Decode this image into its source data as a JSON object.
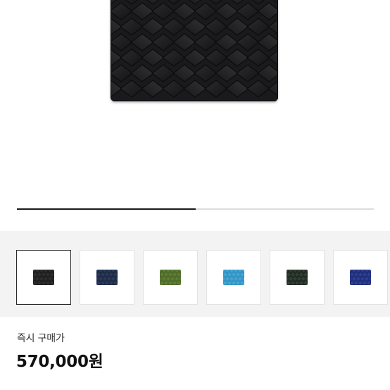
{
  "product_image": {
    "icon": "woven-leather-wallet-image",
    "color": "#1d1d1f"
  },
  "gallery_progress": {
    "fraction": 0.5
  },
  "color_options": [
    {
      "name": "black",
      "color": "#1e1e1e",
      "weave": "#3a3a3a",
      "selected": true
    },
    {
      "name": "navy",
      "color": "#1d2a44",
      "weave": "#34466a",
      "selected": false
    },
    {
      "name": "olive-green",
      "color": "#4e6a2a",
      "weave": "#6b8a40",
      "selected": false
    },
    {
      "name": "sky-blue",
      "color": "#2f93c4",
      "weave": "#57b3de",
      "selected": false
    },
    {
      "name": "black-green",
      "color": "#1f2a22",
      "weave": "#3e4e41",
      "selected": false
    },
    {
      "name": "royal-blue",
      "color": "#1f2d78",
      "weave": "#3b4da6",
      "selected": false
    }
  ],
  "price": {
    "label": "즉시 구매가",
    "value": "570,000원"
  }
}
